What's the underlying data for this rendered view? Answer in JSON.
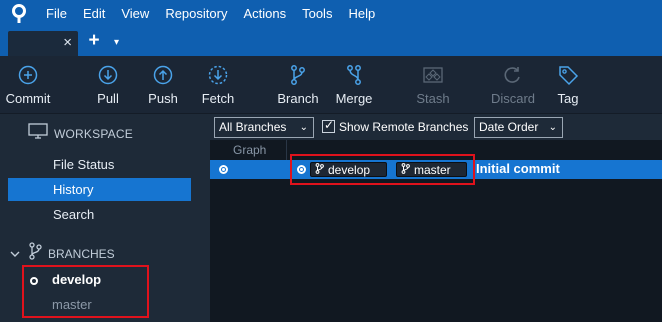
{
  "menubar": {
    "items": [
      "File",
      "Edit",
      "View",
      "Repository",
      "Actions",
      "Tools",
      "Help"
    ]
  },
  "tabs": {
    "close_glyph": "×",
    "add_glyph": "+",
    "menu_glyph": "▾"
  },
  "toolbar": {
    "buttons": [
      {
        "label": "Commit",
        "icon": "commit-icon",
        "enabled": true
      },
      {
        "label": "Pull",
        "icon": "pull-icon",
        "enabled": true
      },
      {
        "label": "Push",
        "icon": "push-icon",
        "enabled": true
      },
      {
        "label": "Fetch",
        "icon": "fetch-icon",
        "enabled": true
      },
      {
        "label": "Branch",
        "icon": "branch-icon",
        "enabled": true
      },
      {
        "label": "Merge",
        "icon": "merge-icon",
        "enabled": true
      },
      {
        "label": "Stash",
        "icon": "stash-icon",
        "enabled": false
      },
      {
        "label": "Discard",
        "icon": "discard-icon",
        "enabled": false
      },
      {
        "label": "Tag",
        "icon": "tag-icon",
        "enabled": true
      }
    ]
  },
  "sidebar": {
    "workspace_title": "WORKSPACE",
    "workspace_items": [
      {
        "label": "File Status",
        "active": false
      },
      {
        "label": "History",
        "active": true
      },
      {
        "label": "Search",
        "active": false
      }
    ],
    "branches_title": "BRANCHES",
    "branches": [
      {
        "name": "develop",
        "current": true
      },
      {
        "name": "master",
        "current": false
      }
    ]
  },
  "main": {
    "branch_filter": "All Branches",
    "show_remote_label": "Show Remote Branches",
    "show_remote_checked": true,
    "sort_order": "Date Order",
    "graph_column": "Graph",
    "commits": [
      {
        "branches": [
          "develop",
          "master"
        ],
        "message": "Initial commit"
      }
    ]
  },
  "colors": {
    "menubar": "#0f5fb0",
    "selection": "#1675d1",
    "highlight": "#e0121c",
    "background": "#1e2a38"
  }
}
